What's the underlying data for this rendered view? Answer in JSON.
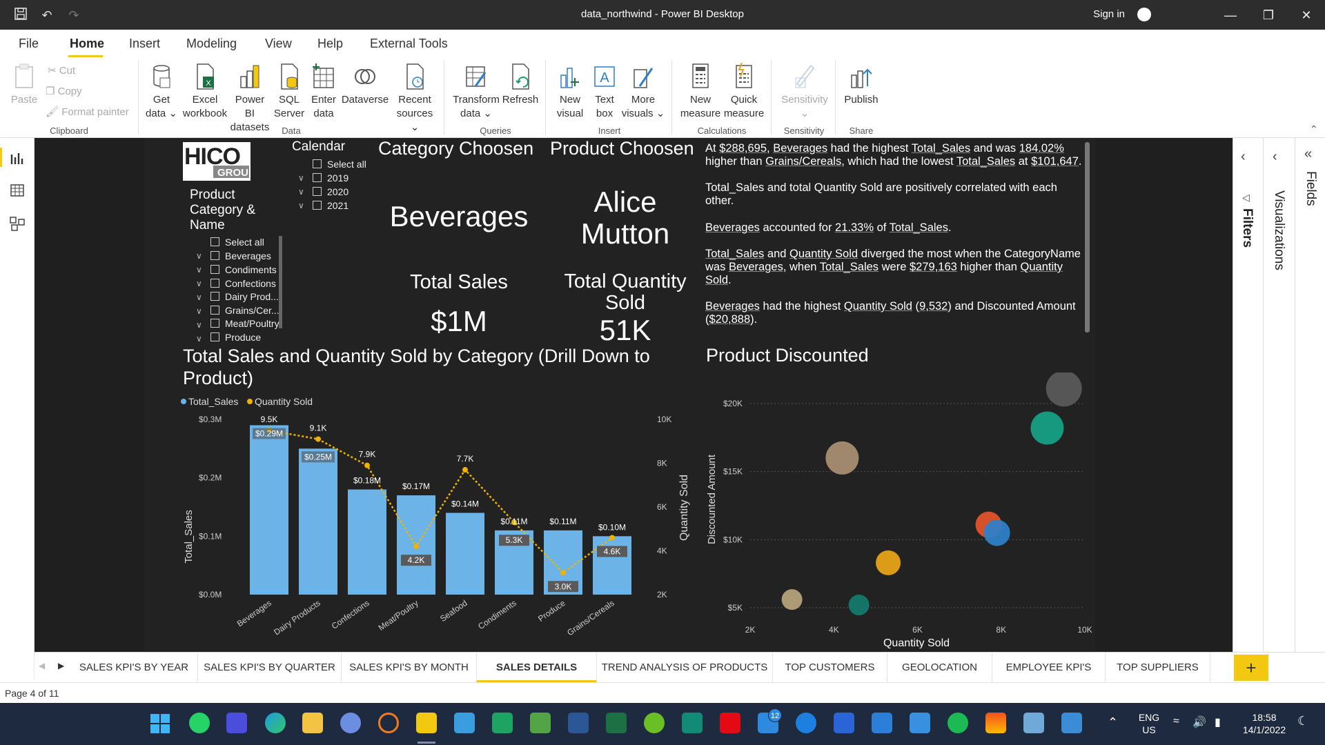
{
  "window": {
    "title": "data_northwind - Power BI Desktop",
    "sign_in": "Sign in"
  },
  "menu": [
    "File",
    "Home",
    "Insert",
    "Modeling",
    "View",
    "Help",
    "External Tools"
  ],
  "ribbon": {
    "clipboard": {
      "paste": "Paste",
      "cut": "Cut",
      "copy": "Copy",
      "format_painter": "Format painter",
      "group": "Clipboard"
    },
    "data": {
      "get_data": [
        "Get",
        "data"
      ],
      "excel": [
        "Excel",
        "workbook"
      ],
      "pbi": [
        "Power BI",
        "datasets"
      ],
      "sql": [
        "SQL",
        "Server"
      ],
      "enter": [
        "Enter",
        "data"
      ],
      "dataverse": "Dataverse",
      "recent": [
        "Recent",
        "sources"
      ],
      "group": "Data"
    },
    "queries": {
      "transform": [
        "Transform",
        "data"
      ],
      "refresh": "Refresh",
      "group": "Queries"
    },
    "insert": {
      "new_visual": [
        "New",
        "visual"
      ],
      "text_box": [
        "Text",
        "box"
      ],
      "more": [
        "More",
        "visuals"
      ],
      "group": "Insert"
    },
    "calc": {
      "new_measure": [
        "New",
        "measure"
      ],
      "quick": [
        "Quick",
        "measure"
      ],
      "group": "Calculations"
    },
    "sens": {
      "label": "Sensitivity",
      "group": "Sensitivity"
    },
    "share": {
      "publish": "Publish",
      "group": "Share"
    }
  },
  "logo": {
    "text1": "HICO",
    "text2": "GROUP"
  },
  "slicer_product": {
    "title": "Product Category & Name",
    "items": [
      "Select all",
      "Beverages",
      "Condiments",
      "Confections",
      "Dairy Prod...",
      "Grains/Cer...",
      "Meat/Poultry",
      "Produce"
    ]
  },
  "slicer_calendar": {
    "title": "Calendar",
    "items": [
      "Select all",
      "2019",
      "2020",
      "2021"
    ]
  },
  "cards": {
    "category_title": "Category Choosen",
    "category_value": "Beverages",
    "product_title": "Product Choosen",
    "product_value_1": "Alice",
    "product_value_2": "Mutton",
    "sales_title": "Total Sales",
    "sales_value": "$1M",
    "qty_title_1": "Total Quantity",
    "qty_title_2": "Sold",
    "qty_value": "51K"
  },
  "insights": [
    {
      "parts": [
        "At ",
        "$288,695",
        ", ",
        "Beverages",
        " had the highest ",
        "Total_Sales",
        " and was ",
        "184.02%",
        " higher than ",
        "Grains/Cereals",
        ", which had the lowest ",
        "Total_Sales",
        " at ",
        "$101,647",
        "."
      ]
    },
    {
      "parts": [
        "Total_Sales and total Quantity Sold are positively correlated with each other."
      ]
    },
    {
      "parts": [
        "Beverages",
        " accounted for ",
        "21.33%",
        " of ",
        "Total_Sales",
        "."
      ]
    },
    {
      "parts": [
        "Total_Sales",
        " and ",
        "Quantity Sold",
        " diverged the most when the CategoryName was ",
        "Beverages",
        ", when ",
        "Total_Sales",
        " were ",
        "$279,163",
        " higher than ",
        "Quantity Sold",
        "."
      ]
    },
    {
      "parts": [
        "Beverages",
        " had the highest ",
        "Quantity Sold",
        " (",
        "9,532",
        ") and Discounted Amount (",
        "$20,888",
        ")."
      ]
    }
  ],
  "chart_data": [
    {
      "type": "bar",
      "title": "Total Sales and Quantity Sold by Category (Drill Down to Product)",
      "legend": [
        "Total_Sales",
        "Quantity Sold"
      ],
      "ylabel": "Total_Sales",
      "y2label": "Quantity Sold",
      "categories": [
        "Beverages",
        "Dairy Products",
        "Confections",
        "Meat/Poultry",
        "Seafood",
        "Condiments",
        "Produce",
        "Grains/Cereals"
      ],
      "series": [
        {
          "name": "Total_Sales",
          "values": [
            0.29,
            0.25,
            0.18,
            0.17,
            0.14,
            0.11,
            0.11,
            0.1
          ],
          "labels": [
            "$0.29M",
            "$0.25M",
            "$0.18M",
            "$0.17M",
            "$0.14M",
            "$0.11M",
            "$0.11M",
            "$0.10M"
          ],
          "color": "#6cb4e8"
        },
        {
          "name": "Quantity Sold",
          "values": [
            9.5,
            9.1,
            7.9,
            4.2,
            7.7,
            5.3,
            3.0,
            4.6
          ],
          "labels": [
            "9.5K",
            "9.1K",
            "7.9K",
            "4.2K",
            "7.7K",
            "5.3K",
            "3.0K",
            "4.6K"
          ],
          "color": "#f0b400"
        }
      ],
      "yticks": [
        "$0.0M",
        "$0.1M",
        "$0.2M",
        "$0.3M"
      ],
      "y2ticks": [
        "2K",
        "4K",
        "6K",
        "8K",
        "10K"
      ],
      "ylim": [
        0,
        0.3
      ],
      "y2lim": [
        2,
        10
      ]
    },
    {
      "type": "scatter",
      "title": "Product Discounted",
      "xlabel": "Quantity Sold",
      "ylabel": "Discounted Amount",
      "xticks": [
        "2K",
        "4K",
        "6K",
        "8K",
        "10K"
      ],
      "yticks": [
        "$5K",
        "$10K",
        "$15K",
        "$20K"
      ],
      "xlim": [
        2,
        10
      ],
      "ylim": [
        5,
        20
      ],
      "points": [
        {
          "x": 9.5,
          "y": 21.1,
          "color": "#5a5a5a"
        },
        {
          "x": 9.1,
          "y": 18.2,
          "color": "#16a085"
        },
        {
          "x": 4.2,
          "y": 16.0,
          "color": "#a88e72"
        },
        {
          "x": 7.7,
          "y": 11.1,
          "color": "#e0542b"
        },
        {
          "x": 7.9,
          "y": 10.5,
          "color": "#2e7fc7"
        },
        {
          "x": 5.3,
          "y": 8.3,
          "color": "#e8a317"
        },
        {
          "x": 3.0,
          "y": 5.6,
          "color": "#b5a27a"
        },
        {
          "x": 4.6,
          "y": 5.2,
          "color": "#13796b"
        }
      ]
    }
  ],
  "panes": {
    "filters": "Filters",
    "visualizations": "Visualizations",
    "fields": "Fields"
  },
  "page_tabs": [
    "SALES KPI'S BY YEAR",
    "SALES KPI'S BY QUARTER",
    "SALES KPI'S BY MONTH",
    "SALES DETAILS",
    "TREND ANALYSIS OF PRODUCTS",
    "TOP CUSTOMERS",
    "GEOLOCATION",
    "EMPLOYEE KPI'S",
    "TOP SUPPLIERS"
  ],
  "active_tab": "SALES DETAILS",
  "status": "Page 4 of 11",
  "tray": {
    "lang1": "ENG",
    "lang2": "US",
    "time": "18:58",
    "date": "14/1/2022",
    "mail_badge": "12"
  }
}
